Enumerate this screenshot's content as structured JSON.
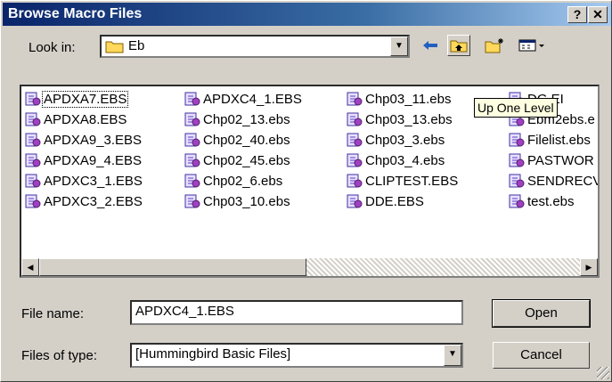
{
  "window": {
    "title": "Browse Macro Files",
    "help_label": "?",
    "close_label": "✕"
  },
  "lookin": {
    "label": "Look in:",
    "value": "Eb"
  },
  "toolbar": {
    "back_icon": "back-arrow-icon",
    "up_icon": "up-one-level-icon",
    "new_folder_icon": "new-folder-icon",
    "views_icon": "views-menu-icon"
  },
  "tooltip": "Up One Level",
  "files": [
    [
      "APDXA7.EBS",
      "APDXA8.EBS",
      "APDXA9_3.EBS",
      "APDXA9_4.EBS",
      "APDXC3_1.EBS",
      "APDXC3_2.EBS"
    ],
    [
      "APDXC4_1.EBS",
      "Chp02_13.ebs",
      "Chp02_40.ebs",
      "Chp02_45.ebs",
      "Chp02_6.ebs",
      "Chp03_10.ebs"
    ],
    [
      "Chp03_11.ebs",
      "Chp03_13.ebs",
      "Chp03_3.ebs",
      "Chp03_4.ebs",
      "CLIPTEST.EBS",
      "DDE.EBS"
    ],
    [
      "DG.EI",
      "Ebm2ebs.e",
      "Filelist.ebs",
      "PASTWOR",
      "SENDRECV",
      "test.ebs"
    ]
  ],
  "filename": {
    "label": "File name:",
    "value": "APDXC4_1.EBS"
  },
  "filetype": {
    "label": "Files of type:",
    "value": "[Hummingbird Basic Files]"
  },
  "buttons": {
    "open": "Open",
    "cancel": "Cancel"
  },
  "scroll": {
    "left_arrow": "◀",
    "right_arrow": "▶"
  }
}
